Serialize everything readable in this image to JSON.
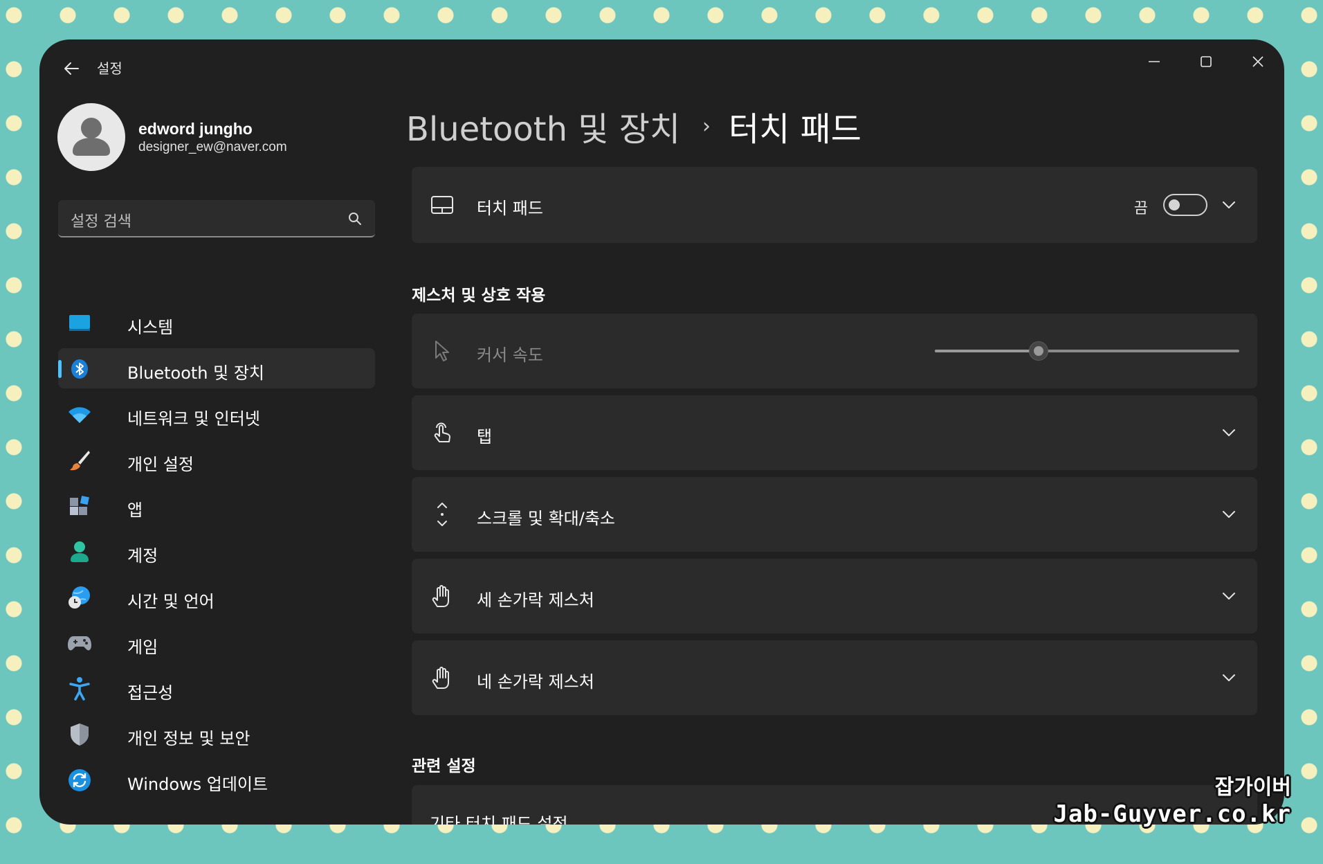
{
  "window": {
    "title": "설정"
  },
  "profile": {
    "name": "edword jungho",
    "email": "designer_ew@naver.com"
  },
  "search": {
    "placeholder": "설정 검색"
  },
  "sidebar": {
    "items": [
      {
        "label": "시스템",
        "icon": "system-icon"
      },
      {
        "label": "Bluetooth 및 장치",
        "icon": "bluetooth-icon",
        "active": true
      },
      {
        "label": "네트워크 및 인터넷",
        "icon": "wifi-icon"
      },
      {
        "label": "개인 설정",
        "icon": "brush-icon"
      },
      {
        "label": "앱",
        "icon": "apps-icon"
      },
      {
        "label": "계정",
        "icon": "account-icon"
      },
      {
        "label": "시간 및 언어",
        "icon": "globe-clock-icon"
      },
      {
        "label": "게임",
        "icon": "gamepad-icon"
      },
      {
        "label": "접근성",
        "icon": "accessibility-icon"
      },
      {
        "label": "개인 정보 및 보안",
        "icon": "shield-icon"
      },
      {
        "label": "Windows 업데이트",
        "icon": "update-icon"
      }
    ]
  },
  "breadcrumb": {
    "parent": "Bluetooth 및 장치",
    "separator": "›",
    "current": "터치 패드"
  },
  "touchpad": {
    "label": "터치 패드",
    "state_label": "끔",
    "enabled": false
  },
  "gestures": {
    "title": "제스처 및 상호 작용",
    "cursor_speed": {
      "label": "커서 속도",
      "value": 0.34
    },
    "items": [
      {
        "label": "탭",
        "icon": "tap-icon"
      },
      {
        "label": "스크롤 및 확대/축소",
        "icon": "scroll-icon"
      },
      {
        "label": "세 손가락 제스처",
        "icon": "three-finger-hand-icon"
      },
      {
        "label": "네 손가락 제스처",
        "icon": "four-finger-hand-icon"
      }
    ]
  },
  "related": {
    "title": "관련 설정",
    "more_label": "기타 터치 패드 설정"
  },
  "watermark": {
    "ko": "잡가이버",
    "en": "Jab-Guyver.co.kr"
  },
  "colors": {
    "accent": "#4cc2ff",
    "background": "#6cc6bd",
    "window": "#202020",
    "card": "#2b2b2b"
  }
}
